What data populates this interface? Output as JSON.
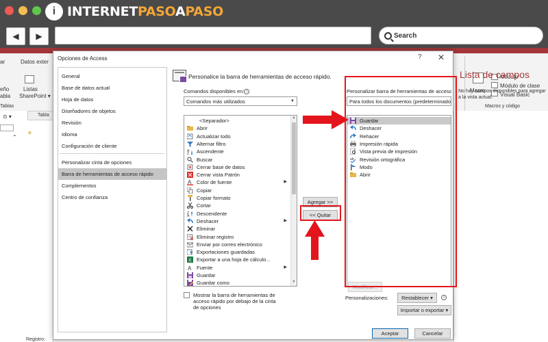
{
  "browser": {
    "logo_mark": "i",
    "logo_part1": "INTERNET",
    "logo_part2": "PASO",
    "logo_part3": "A",
    "logo_part4": "PASO",
    "back_icon": "arrow-left-icon",
    "forward_icon": "arrow-right-icon",
    "search_placeholder": "Search"
  },
  "background": {
    "ribbon_left": "ar",
    "ribbon_tab": "Datos exter",
    "ribbon_lbl1": "eño",
    "ribbon_lbl2": "abla",
    "ribbon_lbl3": "Listas",
    "ribbon_lbl4": "SharePoint ▾",
    "group_tables": "Tablas",
    "table_tab": "Tabla",
    "macro_lbl": "Macro",
    "modulo": "Módulo",
    "modulo_clase": "Módulo de clase",
    "visual_basic": "Visual Basic",
    "macros_group": "Macros y código",
    "field_list_title": "Lista de campos",
    "field_list_msg": "No hay campos disponibles para agregar a la vista actual.",
    "status_text": "Registro:"
  },
  "dialog": {
    "title": "Opciones de Access",
    "help": "?",
    "close": "✕",
    "nav": [
      "General",
      "Base de datos actual",
      "Hoja de datos",
      "Diseñadores de objetos",
      "Revisión",
      "Idioma",
      "Configuración de cliente",
      "Personalizar cinta de opciones",
      "Barra de herramientas de acceso rápido",
      "Complementos",
      "Centro de confianza"
    ],
    "nav_active_index": 8,
    "header": "Personalice la barra de herramientas de acceso rápido.",
    "commands_label": "Comandos disponibles en:",
    "commands_value": "Comandos más utilizados",
    "customize_label": "Personalizar barra de herramientas de acceso rápido:",
    "customize_value": "Para todos los documentos (predeterminado)",
    "left_list": [
      {
        "label": "<Separador>",
        "icon": "separator",
        "sub": false
      },
      {
        "label": "Abrir",
        "icon": "folder-icon",
        "sub": false
      },
      {
        "label": "Actualizar todo",
        "icon": "refresh-icon",
        "sub": false
      },
      {
        "label": "Alternar filtro",
        "icon": "filter-icon",
        "sub": false
      },
      {
        "label": "Ascendente",
        "icon": "sort-asc-icon",
        "sub": false
      },
      {
        "label": "Buscar",
        "icon": "search-icon",
        "sub": false
      },
      {
        "label": "Cerrar base de datos",
        "icon": "close-db-icon",
        "sub": false
      },
      {
        "label": "Cerrar vista Patrón",
        "icon": "close-x-icon",
        "sub": false
      },
      {
        "label": "Color de fuente",
        "icon": "font-color-icon",
        "sub": true
      },
      {
        "label": "Copiar",
        "icon": "copy-icon",
        "sub": false
      },
      {
        "label": "Copiar formato",
        "icon": "format-painter-icon",
        "sub": false
      },
      {
        "label": "Cortar",
        "icon": "scissors-icon",
        "sub": false
      },
      {
        "label": "Descendente",
        "icon": "sort-desc-icon",
        "sub": false
      },
      {
        "label": "Deshacer",
        "icon": "undo-icon",
        "sub": true
      },
      {
        "label": "Eliminar",
        "icon": "delete-x-icon",
        "sub": false
      },
      {
        "label": "Eliminar registro",
        "icon": "delete-record-icon",
        "sub": false
      },
      {
        "label": "Enviar por correo electrónico",
        "icon": "email-icon",
        "sub": false
      },
      {
        "label": "Exportaciones guardadas",
        "icon": "export-saved-icon",
        "sub": false
      },
      {
        "label": "Exportar a una hoja de cálculo...",
        "icon": "excel-icon",
        "sub": false
      },
      {
        "label": "Fuente",
        "icon": "font-icon",
        "sub": true
      },
      {
        "label": "Guardar",
        "icon": "save-icon",
        "sub": false
      },
      {
        "label": "Guardar como",
        "icon": "save-as-icon",
        "sub": false
      }
    ],
    "right_list": [
      {
        "label": "Guardar",
        "icon": "save-icon"
      },
      {
        "label": "Deshacer",
        "icon": "undo-icon"
      },
      {
        "label": "Rehacer",
        "icon": "redo-icon"
      },
      {
        "label": "Impresión rápida",
        "icon": "quick-print-icon"
      },
      {
        "label": "Vista previa de impresión",
        "icon": "print-preview-icon"
      },
      {
        "label": "Revisión ortográfica",
        "icon": "spelling-icon"
      },
      {
        "label": "Modo",
        "icon": "mode-icon"
      },
      {
        "label": "Abrir",
        "icon": "folder-icon"
      }
    ],
    "right_selected_index": 0,
    "add_button": "Agregar >>",
    "remove_button": "<< Quitar",
    "modify_button": "Modificar...",
    "checkbox_label": "Mostrar la barra de herramientas de acceso rápido por debajo de la cinta de opciones",
    "customizations_label": "Personalizaciones:",
    "reset_button": "Restablecer ▾",
    "import_export_button": "Importar o exportar ▾",
    "ok_button": "Aceptar",
    "cancel_button": "Cancelar"
  },
  "colors": {
    "annotation_red": "#e3141b",
    "access_red": "#a4373a",
    "browser_chrome": "#4a4a4a",
    "logo_accent": "#f3a638"
  }
}
